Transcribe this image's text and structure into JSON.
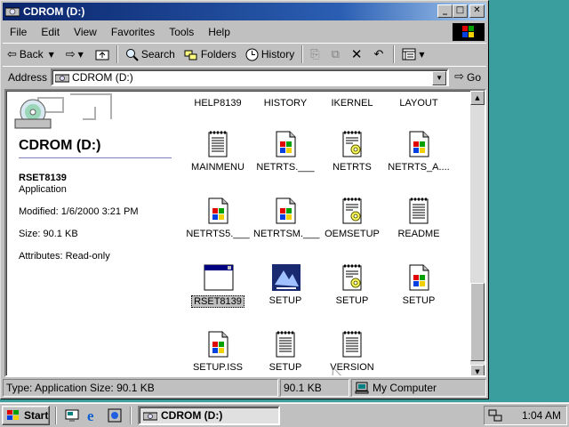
{
  "window": {
    "title": "CDROM (D:)",
    "controls": {
      "minimize": "_",
      "maximize": "□",
      "close": "✕"
    }
  },
  "menubar": {
    "items": [
      "File",
      "Edit",
      "View",
      "Favorites",
      "Tools",
      "Help"
    ]
  },
  "toolbar": {
    "back": "Back",
    "search": "Search",
    "folders": "Folders",
    "history": "History"
  },
  "addressbar": {
    "label": "Address",
    "value": "CDROM (D:)",
    "go": "Go"
  },
  "leftpane": {
    "title": "CDROM (D:)",
    "selected_name": "RSET8139",
    "selected_type": "Application",
    "modified": "Modified: 1/6/2000 3:21 PM",
    "size": "Size: 90.1 KB",
    "attributes": "Attributes: Read-only"
  },
  "files": [
    {
      "label": "HELP8139",
      "icon": "folder-partial"
    },
    {
      "label": "HISTORY",
      "icon": "folder-partial"
    },
    {
      "label": "IKERNEL",
      "icon": "folder-partial"
    },
    {
      "label": "LAYOUT",
      "icon": "folder-partial"
    },
    {
      "label": "MAINMENU",
      "icon": "notepad-icon"
    },
    {
      "label": "NETRTS.___",
      "icon": "windows-file-icon"
    },
    {
      "label": "NETRTS",
      "icon": "setup-info-icon"
    },
    {
      "label": "NETRTS_A....",
      "icon": "windows-file-icon"
    },
    {
      "label": "NETRTS5.___",
      "icon": "windows-file-icon"
    },
    {
      "label": "NETRTSM.___",
      "icon": "windows-file-icon"
    },
    {
      "label": "OEMSETUP",
      "icon": "setup-info-icon"
    },
    {
      "label": "README",
      "icon": "notepad-icon"
    },
    {
      "label": "RSET8139",
      "icon": "application-window-icon",
      "selected": true
    },
    {
      "label": "SETUP",
      "icon": "setup-exe-icon"
    },
    {
      "label": "SETUP",
      "icon": "setup-info-icon"
    },
    {
      "label": "SETUP",
      "icon": "windows-file-icon"
    },
    {
      "label": "SETUP.ISS",
      "icon": "windows-file-icon"
    },
    {
      "label": "SETUP",
      "icon": "notepad-icon"
    },
    {
      "label": "VERSION",
      "icon": "notepad-icon"
    }
  ],
  "statusbar": {
    "info": "Type: Application Size: 90.1 KB",
    "size": "90.1 KB",
    "zone": "My Computer"
  },
  "taskbar": {
    "start": "Start",
    "task": "CDROM (D:)",
    "clock": "1:04 AM"
  },
  "colors": {
    "desktop": "#3a9e9e",
    "titlebar_start": "#0a246a",
    "titlebar_end": "#a6caf0",
    "face": "#c0c0c0"
  }
}
